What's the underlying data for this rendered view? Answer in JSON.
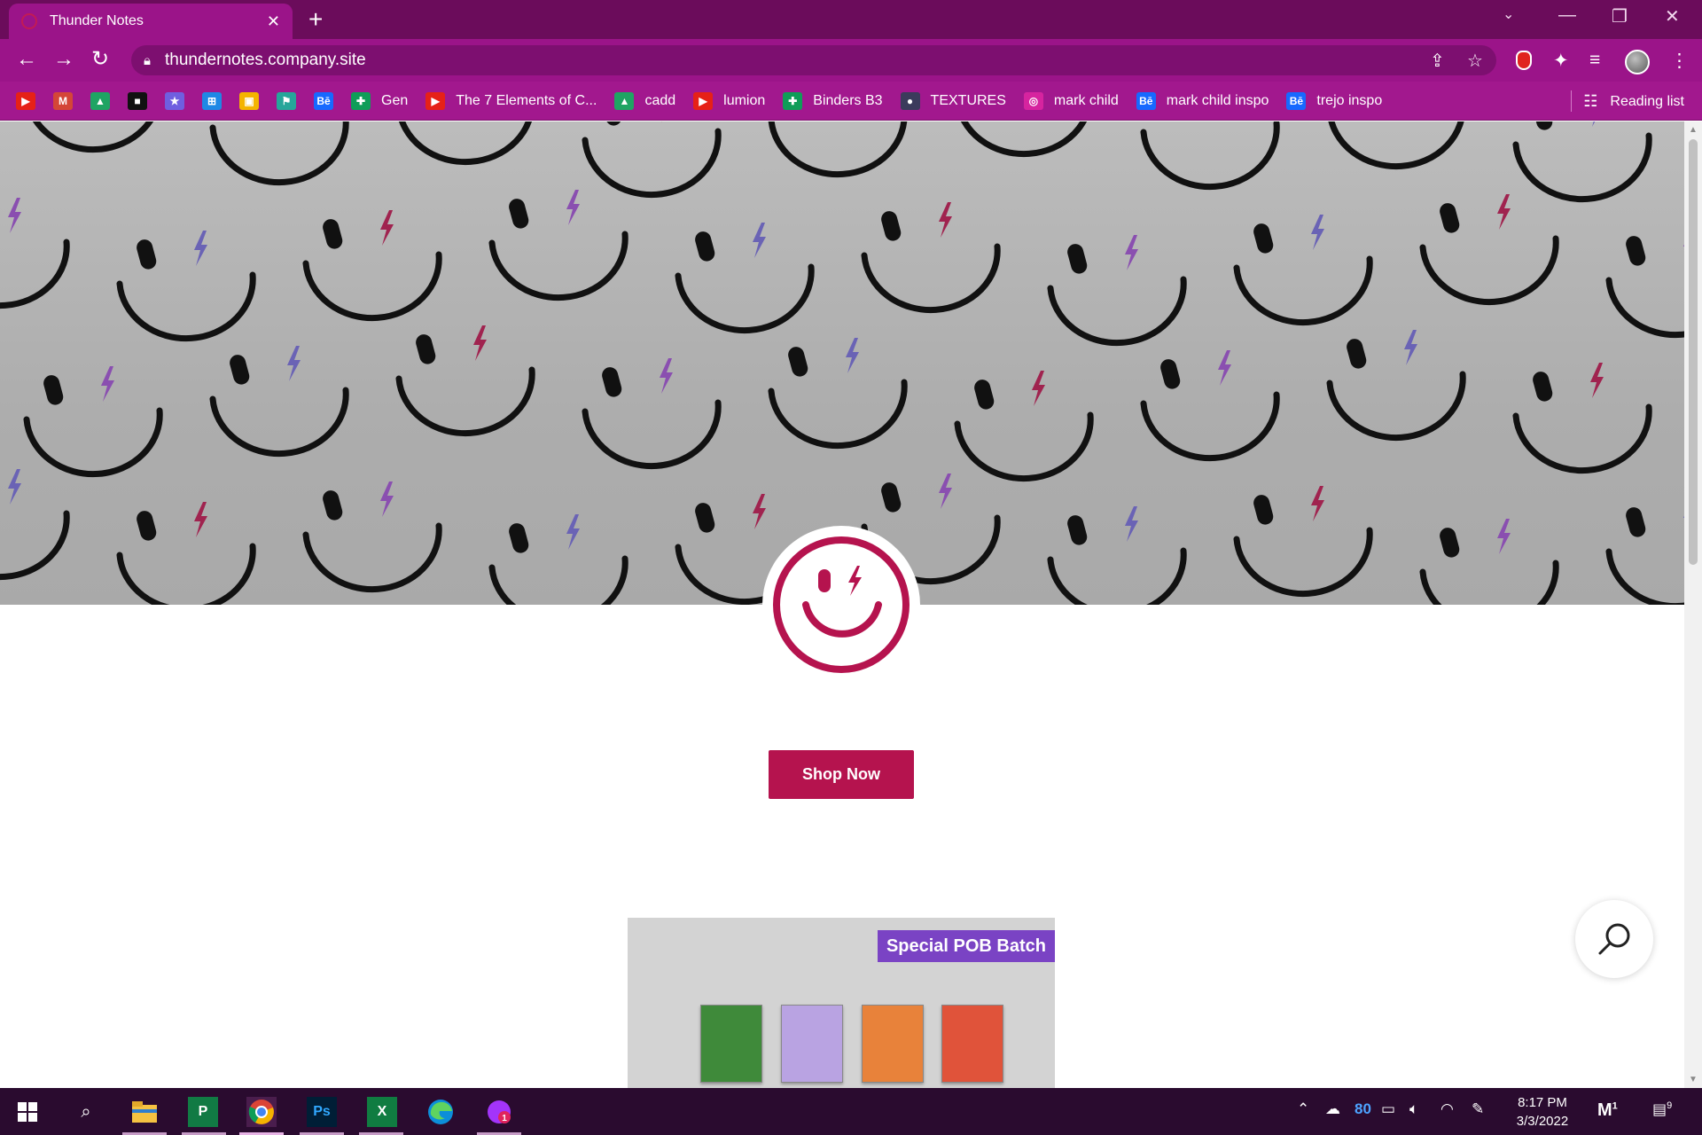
{
  "browser": {
    "tab_title": "Thunder Notes",
    "url": "thundernotes.company.site",
    "bookmarks": [
      {
        "label": "",
        "icon": "youtube-icon",
        "color": "#e62117",
        "glyph": "▶"
      },
      {
        "label": "",
        "icon": "gmail-icon",
        "color": "#d44638",
        "glyph": "M"
      },
      {
        "label": "",
        "icon": "google-drive-icon",
        "color": "#1fa463",
        "glyph": "▲"
      },
      {
        "label": "",
        "icon": "unsplash-icon",
        "color": "#111111",
        "glyph": "■"
      },
      {
        "label": "",
        "icon": "star-app-icon",
        "color": "#6f5fe0",
        "glyph": "★"
      },
      {
        "label": "",
        "icon": "store-icon",
        "color": "#1e88e5",
        "glyph": "⊞"
      },
      {
        "label": "",
        "icon": "classroom-icon",
        "color": "#f4b400",
        "glyph": "▣"
      },
      {
        "label": "",
        "icon": "flag-icon",
        "color": "#26a69a",
        "glyph": "⚑"
      },
      {
        "label": "",
        "icon": "behance-icon",
        "color": "#1769ff",
        "glyph": "Bē"
      },
      {
        "label": "Gen",
        "icon": "sheets-icon",
        "color": "#0f9d58",
        "glyph": "✚"
      },
      {
        "label": "The 7 Elements of C...",
        "icon": "youtube-icon",
        "color": "#e62117",
        "glyph": "▶"
      },
      {
        "label": "cadd",
        "icon": "google-drive-icon",
        "color": "#1fa463",
        "glyph": "▲"
      },
      {
        "label": "lumion",
        "icon": "youtube-icon",
        "color": "#e62117",
        "glyph": "▶"
      },
      {
        "label": "Binders B3",
        "icon": "sheets-icon",
        "color": "#0f9d58",
        "glyph": "✚"
      },
      {
        "label": "TEXTURES",
        "icon": "person-icon",
        "color": "#3b3b5c",
        "glyph": "●"
      },
      {
        "label": "mark child",
        "icon": "instagram-icon",
        "color": "#d6249f",
        "glyph": "◎"
      },
      {
        "label": "mark child inspo",
        "icon": "behance-icon",
        "color": "#1769ff",
        "glyph": "Bē"
      },
      {
        "label": "trejo inspo",
        "icon": "behance-icon",
        "color": "#1769ff",
        "glyph": "Bē"
      }
    ],
    "reading_list_label": "Reading list"
  },
  "page": {
    "shop_button_label": "Shop Now",
    "promo_label": "Special POB Batch",
    "brand_color": "#b5134e",
    "promo_color": "#7a43c4",
    "card_colors": [
      "#3f8a3a",
      "#b9a3e2",
      "#e8823a",
      "#e0533a"
    ]
  },
  "taskbar": {
    "clock_time": "8:17 PM",
    "clock_date": "3/3/2022",
    "battery_text": "80",
    "mail_badge": "1",
    "notification_badge": "9"
  }
}
